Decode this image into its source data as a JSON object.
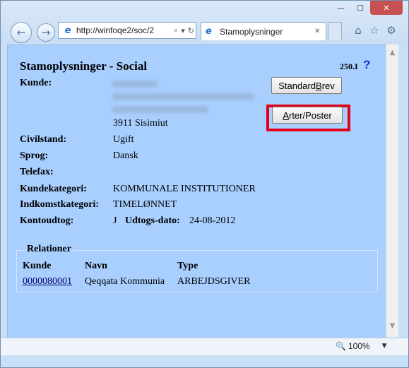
{
  "browser": {
    "address_url": "http://winfoqe2/soc/2",
    "tab_title": "Stamoplysninger",
    "zoom_level": "100%",
    "window_controls": {
      "minimize": "—",
      "maximize": "☐",
      "close": "✕"
    },
    "icons": {
      "back": "←",
      "forward": "→",
      "search": "⌕",
      "dropdown": "▾",
      "refresh": "↻",
      "tab_close": "✕",
      "home": "⌂",
      "favorites": "☆",
      "tools": "⚙",
      "ie": "e",
      "zoom": "🔍",
      "zoom_dropdown": "▼",
      "scroll_up": "▲",
      "scroll_down": "▼"
    }
  },
  "page": {
    "title": "Stamoplysninger - Social",
    "version": "250.I",
    "help": "?",
    "fields": {
      "kunde_label": "Kunde:",
      "kunde_city": "3911 Sisimiut",
      "civilstand_label": "Civilstand:",
      "civilstand_value": "Ugift",
      "sprog_label": "Sprog:",
      "sprog_value": "Dansk",
      "telefax_label": "Telefax:",
      "kundekategori_label": "Kundekategori:",
      "kundekategori_value": "KOMMUNALE INSTITUTIONER",
      "indkomstkategori_label": "Indkomstkategori:",
      "indkomstkategori_value": "TIMELØNNET",
      "kontoudtog_label": "Kontoudtog:",
      "kontoudtog_value": "J",
      "udtogs_label": "Udtogs-dato:",
      "udtogs_value": "24-08-2012"
    },
    "buttons": {
      "standardbrev_pre": "Standard",
      "standardbrev_key": "B",
      "standardbrev_post": "rev",
      "arter_pre": "",
      "arter_key": "A",
      "arter_post": "rter/Poster"
    },
    "relationer": {
      "legend": "Relationer",
      "headers": [
        "Kunde",
        "Navn",
        "Type"
      ],
      "rows": [
        [
          "0000080001",
          "Qeqqata Kommunia",
          "ARBEJDSGIVER"
        ]
      ]
    }
  }
}
